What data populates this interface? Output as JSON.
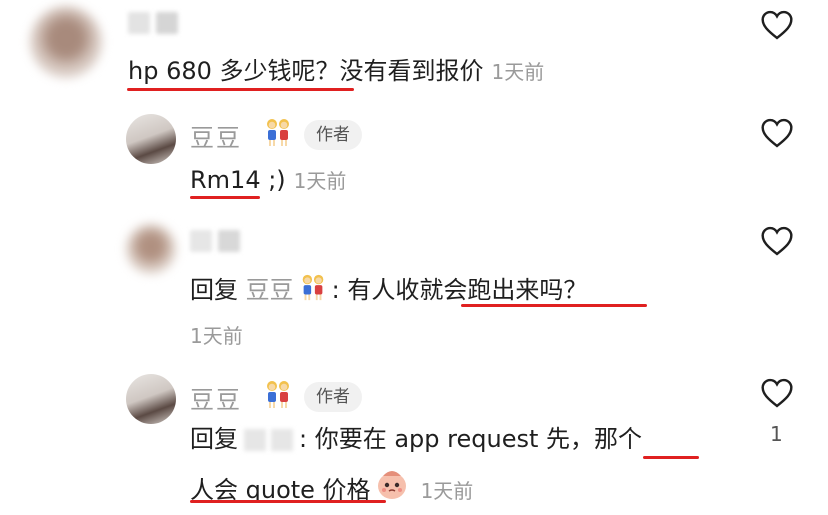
{
  "comments": [
    {
      "id": "c1",
      "text": "hp 680 多少钱呢？没有看到报价",
      "time": "1天前"
    },
    {
      "id": "c2",
      "user": "豆豆",
      "badge": "作者",
      "text": "Rm14 ;)",
      "time": "1天前"
    },
    {
      "id": "c3",
      "reply_prefix": "回复",
      "reply_to": "豆豆",
      "text_after": ": 有人收就会跑出来吗？",
      "time": "1天前"
    },
    {
      "id": "c4",
      "user": "豆豆",
      "badge": "作者",
      "reply_prefix": "回复",
      "text_line1": ": 你要在 app request 先，那个",
      "text_line2": "人会 quote 价格",
      "time": "1天前",
      "likes": "1"
    }
  ],
  "icons": {
    "like": "heart-outline-icon",
    "couple_emoji": "two-women-emoji-icon",
    "pleading_emoji": "pleading-face-emoji-icon"
  },
  "colors": {
    "underline": "#e02020",
    "muted": "#9a9a9a"
  }
}
